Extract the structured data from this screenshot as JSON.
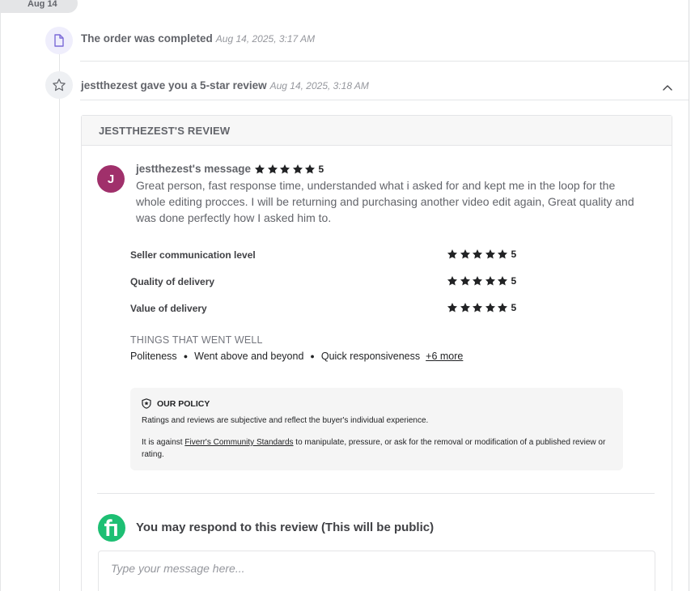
{
  "timeline": {
    "date_label": "Aug 14",
    "events": [
      {
        "title": "The order was completed",
        "timestamp": "Aug 14, 2025, 3:17 AM",
        "icon": "document-icon"
      },
      {
        "title": "jestthezest gave you a 5-star review",
        "timestamp": "Aug 14, 2025, 3:18 AM",
        "icon": "star-outline-icon"
      }
    ]
  },
  "review": {
    "header": "JESTTHEZEST'S REVIEW",
    "avatar_initial": "J",
    "avatar_color": "#a0306b",
    "message_title": "jestthezest's message",
    "overall_rating": "5",
    "message": "Great person, fast response time, understanded what i asked for and kept me in the loop for the whole editing procces. I will be returning and purchasing another video edit again, Great quality and was done perfectly how I asked him to.",
    "criteria": [
      {
        "label": "Seller communication level",
        "rating": "5"
      },
      {
        "label": "Quality of delivery",
        "rating": "5"
      },
      {
        "label": "Value of delivery",
        "rating": "5"
      }
    ],
    "went_well": {
      "title": "THINGS THAT WENT WELL",
      "items": [
        "Politeness",
        "Went above and beyond",
        "Quick responsiveness"
      ],
      "more_label": "+6 more"
    },
    "policy": {
      "title": "OUR POLICY",
      "line1": "Ratings and reviews are subjective and reflect the buyer's individual experience.",
      "line2_before": "It is against ",
      "line2_link": "Fiverr's Community Standards",
      "line2_after": " to manipulate, pressure, or ask for the removal or modification of a published review or rating."
    },
    "respond": {
      "title": "You may respond to this review (This will be public)",
      "placeholder": "Type your message here..."
    }
  },
  "colors": {
    "star": "#222325",
    "fiverr_green": "#1dbf73"
  }
}
